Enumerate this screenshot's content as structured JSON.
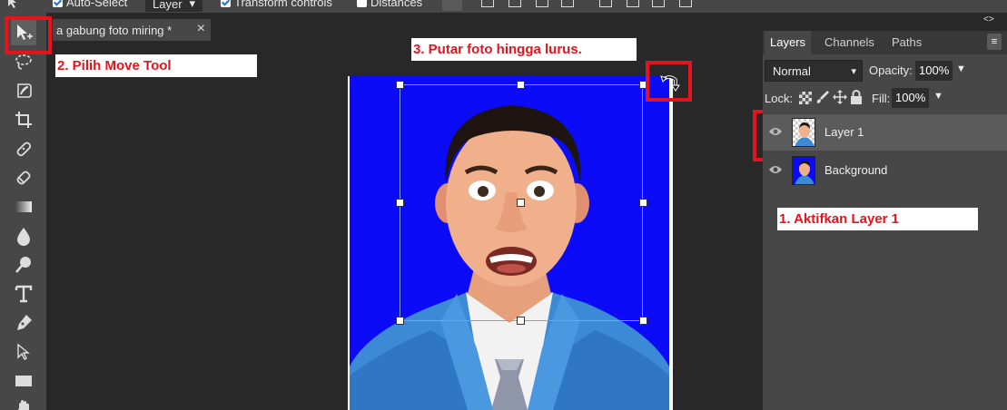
{
  "options_bar": {
    "auto_select_label": "Auto-Select",
    "auto_select_checked": true,
    "target_value": "Layer",
    "transform_controls_label": "Transform controls",
    "transform_controls_checked": true,
    "distances_label": "Distances",
    "distances_checked": false
  },
  "document_tab": {
    "title": "a gabung foto miring *",
    "close_glyph": "×"
  },
  "annotations": {
    "step1": "1. Aktifkan Layer 1",
    "step2": "2. Pilih Move Tool",
    "step3": "3. Putar foto hingga lurus.",
    "color": "#e3141e"
  },
  "toolbar": {
    "tools": [
      "move-tool",
      "lasso-tool",
      "quick-selection-tool",
      "crop-tool",
      "healing-tool",
      "eraser-tool",
      "gradient-tool",
      "blur-tool",
      "dodge-tool",
      "type-tool",
      "pen-tool",
      "path-selection-tool",
      "rectangle-tool",
      "hand-tool"
    ],
    "active": "move-tool"
  },
  "layers_panel": {
    "tabs": [
      "Layers",
      "Channels",
      "Paths"
    ],
    "active_tab": "Layers",
    "menu_glyph": "≡",
    "blend_mode": "Normal",
    "opacity_label": "Opacity:",
    "opacity_value": "100%",
    "lock_label": "Lock:",
    "fill_label": "Fill:",
    "fill_value": "100%",
    "layers": [
      {
        "name": "Layer 1",
        "selected": true,
        "visible": true
      },
      {
        "name": "Background",
        "selected": false,
        "visible": true
      }
    ]
  },
  "panel_collapse_glyph": "<>",
  "colors": {
    "canvas_bg": "#0b0bf7",
    "ui_dark": "#282828",
    "ui_panel": "#474747"
  }
}
